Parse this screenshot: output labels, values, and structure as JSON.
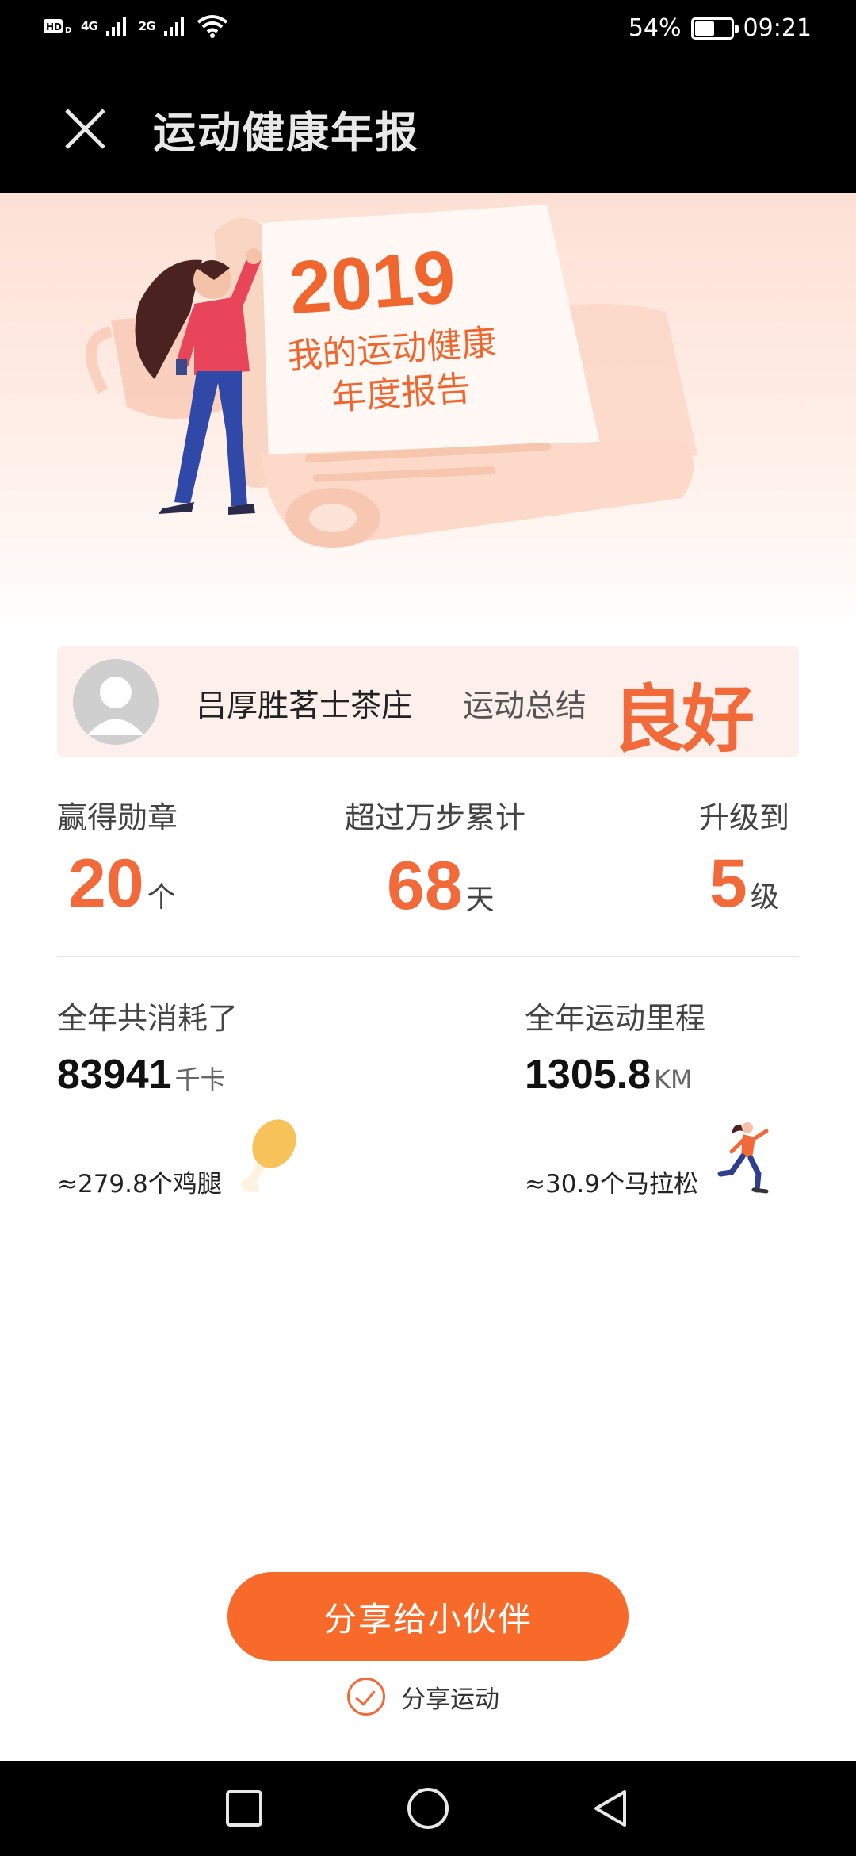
{
  "status_bar": {
    "network_left": "HD",
    "signal_1": "4G",
    "signal_2": "2G",
    "battery_percent": "54%",
    "battery_level": 0.54,
    "time": "09:21"
  },
  "header": {
    "title": "运动健康年报",
    "close_icon": "close-icon"
  },
  "banner": {
    "year": "2019",
    "line1": "我的运动健康",
    "line2": "年度报告"
  },
  "summary": {
    "username": "吕厚胜茗士茶庄",
    "label": "运动总结",
    "rating": "良好"
  },
  "stats": {
    "medals": {
      "label": "赢得勋章",
      "value": "20",
      "unit": "个"
    },
    "steps": {
      "label": "超过万步累计",
      "value": "68",
      "unit": "天"
    },
    "level": {
      "label": "升级到",
      "value": "5",
      "unit": "级"
    }
  },
  "totals": {
    "calories": {
      "label": "全年共消耗了",
      "value": "83941",
      "unit": "千卡",
      "equivalent": "≈279.8个鸡腿"
    },
    "distance": {
      "label": "全年运动里程",
      "value": "1305.8",
      "unit": "KM",
      "equivalent": "≈30.9个马拉松"
    }
  },
  "actions": {
    "share_button": "分享给小伙伴",
    "share_check_label": "分享运动",
    "share_checked": true
  },
  "nav": {
    "recent": "square-icon",
    "home": "circle-icon",
    "back": "triangle-back-icon"
  },
  "colors": {
    "accent": "#f26a3a",
    "button": "#f76a2a",
    "bar": "#000000"
  }
}
